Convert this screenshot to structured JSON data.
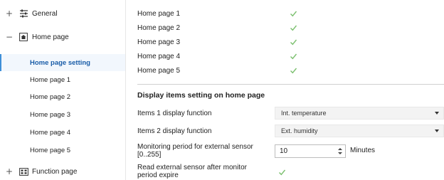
{
  "sidebar": {
    "general": {
      "toggle": "+",
      "label": "General",
      "icon": "sliders-icon"
    },
    "home_page": {
      "toggle": "−",
      "label": "Home page",
      "icon": "home-icon"
    },
    "sub_items": [
      {
        "label": "Home page setting",
        "active": true
      },
      {
        "label": "Home page 1"
      },
      {
        "label": "Home page 2"
      },
      {
        "label": "Home page 3"
      },
      {
        "label": "Home page 4"
      },
      {
        "label": "Home page 5"
      }
    ],
    "function_page": {
      "toggle": "+",
      "label": "Function page",
      "icon": "grid-icon"
    }
  },
  "main": {
    "home_pages": [
      {
        "label": "Home page 1",
        "checked": true
      },
      {
        "label": "Home page 2",
        "checked": true
      },
      {
        "label": "Home page 3",
        "checked": true
      },
      {
        "label": "Home page 4",
        "checked": true
      },
      {
        "label": "Home page 5",
        "checked": true
      }
    ],
    "section_title": "Display items setting on home page",
    "items1": {
      "label": "Items 1 display function",
      "value": "Int. temperature"
    },
    "items2": {
      "label": "Items 2 display function",
      "value": "Ext. humidity"
    },
    "monitoring": {
      "label_line1": "Monitoring period for external sensor",
      "label_line2": "[0..255]",
      "value": "10",
      "unit": "Minutes"
    },
    "read_sensor": {
      "label_line1": "Read external sensor after monitor",
      "label_line2": "period expire",
      "checked": true
    }
  },
  "colors": {
    "accent": "#3e8fd8",
    "check": "#7cc06f",
    "active_bg": "#f2f7fd"
  }
}
